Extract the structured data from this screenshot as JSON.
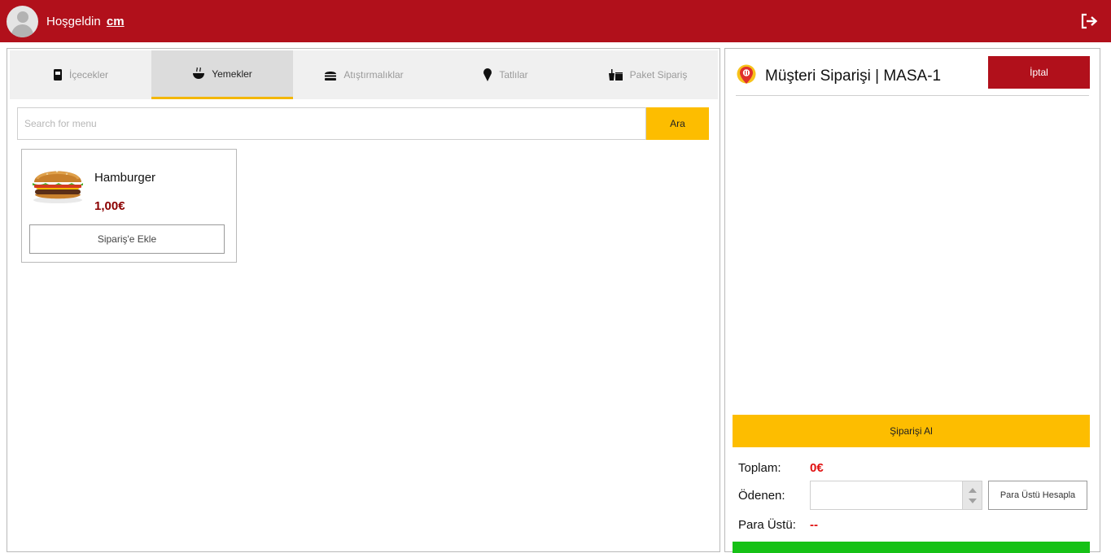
{
  "header": {
    "welcome": "Hoşgeldin",
    "username": "cm",
    "background": "#b1101b"
  },
  "tabs": [
    {
      "label": "İçecekler",
      "icon": "drink-cup-icon",
      "active": false
    },
    {
      "label": "Yemekler",
      "icon": "food-bowl-icon",
      "active": true
    },
    {
      "label": "Atıştırmalıklar",
      "icon": "burger-icon",
      "active": false
    },
    {
      "label": "Tatlılar",
      "icon": "ice-cream-icon",
      "active": false
    },
    {
      "label": "Paket Sipariş",
      "icon": "takeaway-icon",
      "active": false
    }
  ],
  "search": {
    "placeholder": "Search for menu",
    "button": "Ara"
  },
  "products": [
    {
      "name": "Hamburger",
      "price": "1,00€",
      "add_label": "Sipariş'e Ekle"
    }
  ],
  "order": {
    "title": "Müşteri Siparişi | MASA-1",
    "cancel": "İptal",
    "take_order": "Şiparişi Al",
    "total_label": "Toplam:",
    "total_value": "0€",
    "paid_label": "Ödenen:",
    "change_button": "Para Üstü Hesapla",
    "change_label": "Para Üstü:",
    "change_value": "--"
  },
  "colors": {
    "accent_red": "#b1101b",
    "accent_yellow": "#fdbd00",
    "price_red": "#8b0000",
    "success_green": "#16c116"
  }
}
